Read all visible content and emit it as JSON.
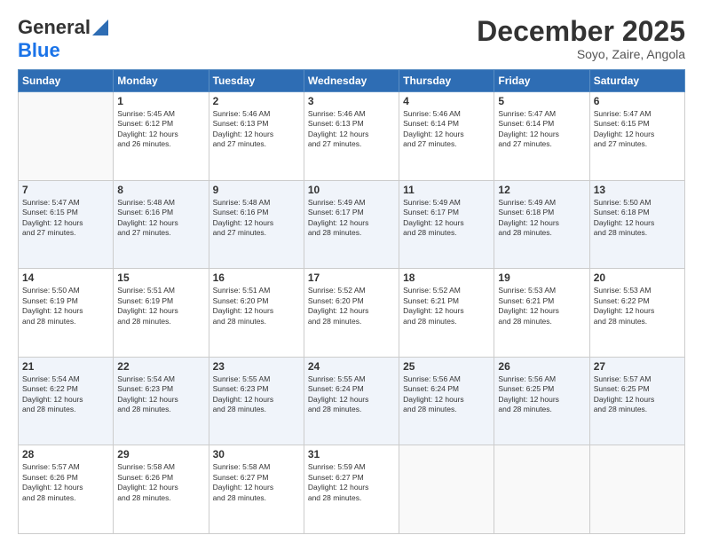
{
  "header": {
    "logo_general": "General",
    "logo_blue": "Blue",
    "month_title": "December 2025",
    "location": "Soyo, Zaire, Angola"
  },
  "days_of_week": [
    "Sunday",
    "Monday",
    "Tuesday",
    "Wednesday",
    "Thursday",
    "Friday",
    "Saturday"
  ],
  "weeks": [
    {
      "shaded": false,
      "days": [
        {
          "num": "",
          "info": ""
        },
        {
          "num": "1",
          "info": "Sunrise: 5:45 AM\nSunset: 6:12 PM\nDaylight: 12 hours\nand 26 minutes."
        },
        {
          "num": "2",
          "info": "Sunrise: 5:46 AM\nSunset: 6:13 PM\nDaylight: 12 hours\nand 27 minutes."
        },
        {
          "num": "3",
          "info": "Sunrise: 5:46 AM\nSunset: 6:13 PM\nDaylight: 12 hours\nand 27 minutes."
        },
        {
          "num": "4",
          "info": "Sunrise: 5:46 AM\nSunset: 6:14 PM\nDaylight: 12 hours\nand 27 minutes."
        },
        {
          "num": "5",
          "info": "Sunrise: 5:47 AM\nSunset: 6:14 PM\nDaylight: 12 hours\nand 27 minutes."
        },
        {
          "num": "6",
          "info": "Sunrise: 5:47 AM\nSunset: 6:15 PM\nDaylight: 12 hours\nand 27 minutes."
        }
      ]
    },
    {
      "shaded": true,
      "days": [
        {
          "num": "7",
          "info": "Sunrise: 5:47 AM\nSunset: 6:15 PM\nDaylight: 12 hours\nand 27 minutes."
        },
        {
          "num": "8",
          "info": "Sunrise: 5:48 AM\nSunset: 6:16 PM\nDaylight: 12 hours\nand 27 minutes."
        },
        {
          "num": "9",
          "info": "Sunrise: 5:48 AM\nSunset: 6:16 PM\nDaylight: 12 hours\nand 27 minutes."
        },
        {
          "num": "10",
          "info": "Sunrise: 5:49 AM\nSunset: 6:17 PM\nDaylight: 12 hours\nand 28 minutes."
        },
        {
          "num": "11",
          "info": "Sunrise: 5:49 AM\nSunset: 6:17 PM\nDaylight: 12 hours\nand 28 minutes."
        },
        {
          "num": "12",
          "info": "Sunrise: 5:49 AM\nSunset: 6:18 PM\nDaylight: 12 hours\nand 28 minutes."
        },
        {
          "num": "13",
          "info": "Sunrise: 5:50 AM\nSunset: 6:18 PM\nDaylight: 12 hours\nand 28 minutes."
        }
      ]
    },
    {
      "shaded": false,
      "days": [
        {
          "num": "14",
          "info": "Sunrise: 5:50 AM\nSunset: 6:19 PM\nDaylight: 12 hours\nand 28 minutes."
        },
        {
          "num": "15",
          "info": "Sunrise: 5:51 AM\nSunset: 6:19 PM\nDaylight: 12 hours\nand 28 minutes."
        },
        {
          "num": "16",
          "info": "Sunrise: 5:51 AM\nSunset: 6:20 PM\nDaylight: 12 hours\nand 28 minutes."
        },
        {
          "num": "17",
          "info": "Sunrise: 5:52 AM\nSunset: 6:20 PM\nDaylight: 12 hours\nand 28 minutes."
        },
        {
          "num": "18",
          "info": "Sunrise: 5:52 AM\nSunset: 6:21 PM\nDaylight: 12 hours\nand 28 minutes."
        },
        {
          "num": "19",
          "info": "Sunrise: 5:53 AM\nSunset: 6:21 PM\nDaylight: 12 hours\nand 28 minutes."
        },
        {
          "num": "20",
          "info": "Sunrise: 5:53 AM\nSunset: 6:22 PM\nDaylight: 12 hours\nand 28 minutes."
        }
      ]
    },
    {
      "shaded": true,
      "days": [
        {
          "num": "21",
          "info": "Sunrise: 5:54 AM\nSunset: 6:22 PM\nDaylight: 12 hours\nand 28 minutes."
        },
        {
          "num": "22",
          "info": "Sunrise: 5:54 AM\nSunset: 6:23 PM\nDaylight: 12 hours\nand 28 minutes."
        },
        {
          "num": "23",
          "info": "Sunrise: 5:55 AM\nSunset: 6:23 PM\nDaylight: 12 hours\nand 28 minutes."
        },
        {
          "num": "24",
          "info": "Sunrise: 5:55 AM\nSunset: 6:24 PM\nDaylight: 12 hours\nand 28 minutes."
        },
        {
          "num": "25",
          "info": "Sunrise: 5:56 AM\nSunset: 6:24 PM\nDaylight: 12 hours\nand 28 minutes."
        },
        {
          "num": "26",
          "info": "Sunrise: 5:56 AM\nSunset: 6:25 PM\nDaylight: 12 hours\nand 28 minutes."
        },
        {
          "num": "27",
          "info": "Sunrise: 5:57 AM\nSunset: 6:25 PM\nDaylight: 12 hours\nand 28 minutes."
        }
      ]
    },
    {
      "shaded": false,
      "days": [
        {
          "num": "28",
          "info": "Sunrise: 5:57 AM\nSunset: 6:26 PM\nDaylight: 12 hours\nand 28 minutes."
        },
        {
          "num": "29",
          "info": "Sunrise: 5:58 AM\nSunset: 6:26 PM\nDaylight: 12 hours\nand 28 minutes."
        },
        {
          "num": "30",
          "info": "Sunrise: 5:58 AM\nSunset: 6:27 PM\nDaylight: 12 hours\nand 28 minutes."
        },
        {
          "num": "31",
          "info": "Sunrise: 5:59 AM\nSunset: 6:27 PM\nDaylight: 12 hours\nand 28 minutes."
        },
        {
          "num": "",
          "info": ""
        },
        {
          "num": "",
          "info": ""
        },
        {
          "num": "",
          "info": ""
        }
      ]
    }
  ]
}
